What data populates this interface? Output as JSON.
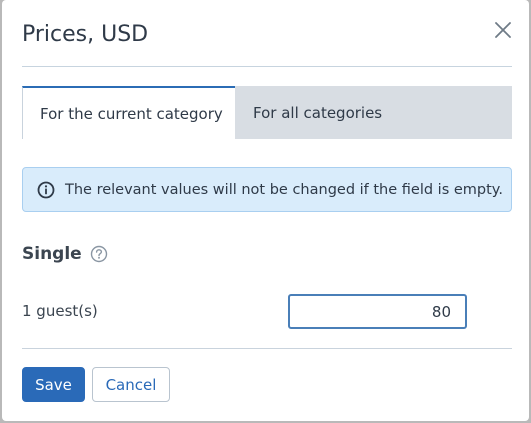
{
  "dialog": {
    "title": "Prices, USD"
  },
  "tabs": [
    {
      "label": "For the current category",
      "active": true
    },
    {
      "label": "For all categories",
      "active": false
    }
  ],
  "info": {
    "message": "The relevant values will not be changed if the field is empty."
  },
  "section": {
    "title": "Single",
    "help_icon": "question-circle-icon"
  },
  "fields": [
    {
      "label": "1 guest(s)",
      "value": "80"
    }
  ],
  "buttons": {
    "save_label": "Save",
    "cancel_label": "Cancel"
  },
  "colors": {
    "accent": "#2a6ab8",
    "info_bg": "#d9ecfb",
    "inactive_tab_bg": "#d8dde3",
    "overlay": "#b9b9b9"
  }
}
